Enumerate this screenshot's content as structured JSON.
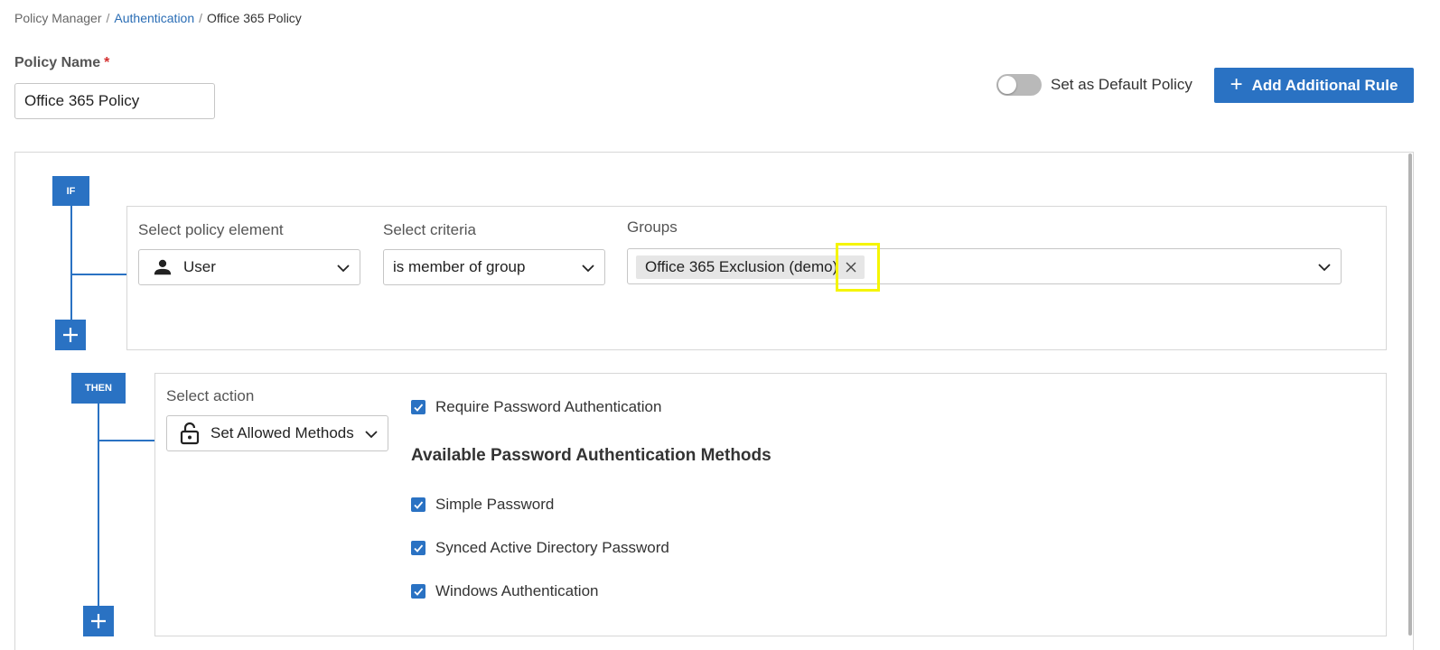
{
  "breadcrumb": {
    "root": "Policy Manager",
    "middle": "Authentication",
    "current": "Office 365 Policy",
    "separator": "/"
  },
  "policy": {
    "label": "Policy Name",
    "required_mark": "*",
    "value": "Office 365 Policy"
  },
  "header": {
    "default_toggle_label": "Set as Default Policy",
    "default_toggle_on": false,
    "add_rule_label": "Add Additional Rule"
  },
  "if_block": {
    "badge": "IF",
    "element_label": "Select policy element",
    "element_value": "User",
    "criteria_label": "Select criteria",
    "criteria_value": "is member of group",
    "groups_label": "Groups",
    "group_chip": "Office 365 Exclusion (demo)"
  },
  "then_block": {
    "badge": "THEN",
    "action_label": "Select action",
    "action_value": "Set Allowed Methods",
    "require_password": "Require Password Authentication",
    "methods_title": "Available Password Authentication Methods",
    "methods": [
      "Simple Password",
      "Synced Active Directory Password",
      "Windows Authentication"
    ]
  },
  "colors": {
    "accent": "#2a72c3",
    "link": "#2a6db5",
    "required": "#d32f2f",
    "highlight": "#f5f500"
  }
}
